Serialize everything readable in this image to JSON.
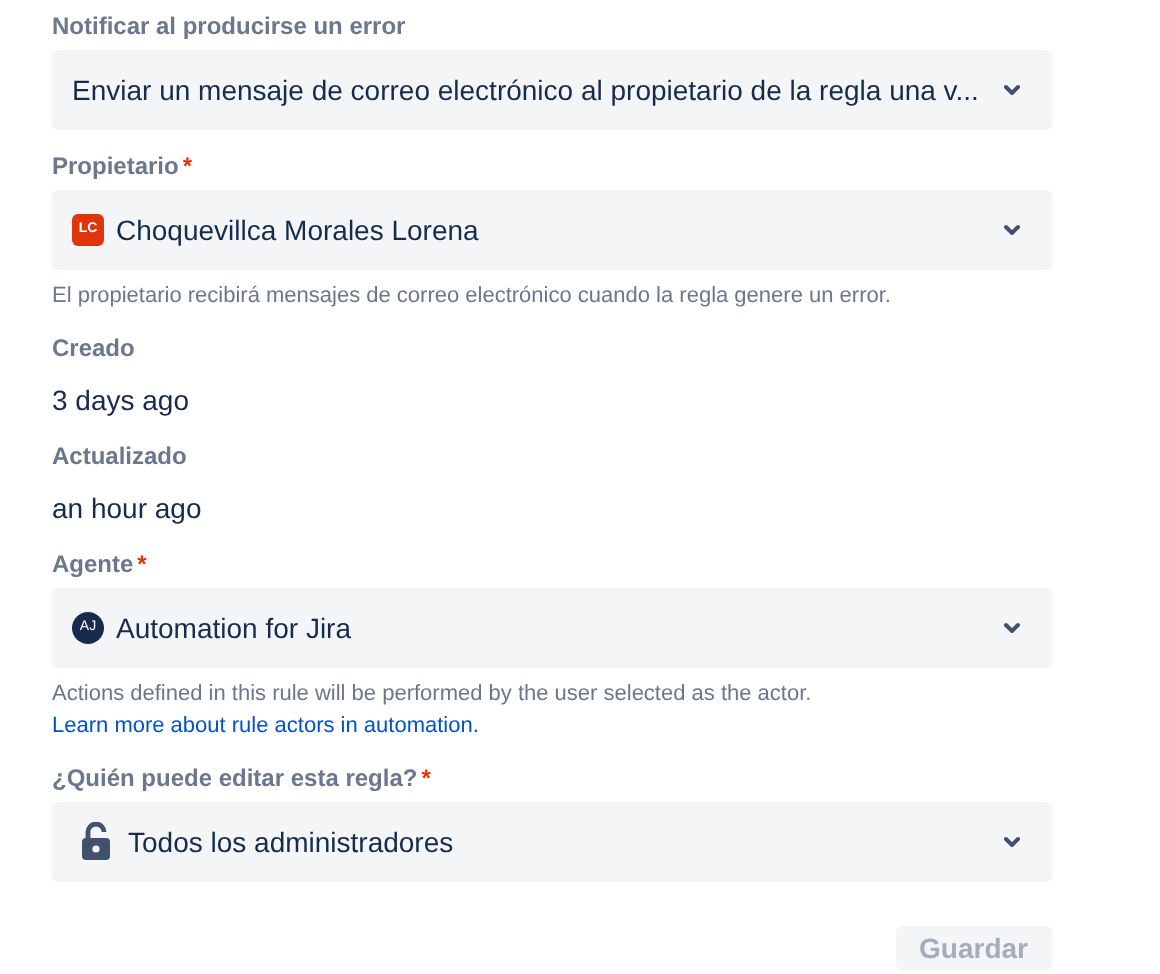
{
  "fields": [
    {
      "kind": "select",
      "label": "Notificar al producirse un error",
      "required": false,
      "value": "Enviar un mensaje de correo electrónico al propietario de la regla una v..."
    },
    {
      "kind": "select",
      "label": "Propietario",
      "required": true,
      "required_mark": "*",
      "value": "Choquevillca Morales Lorena",
      "lead": {
        "kind": "avatar_square",
        "initials": "LC",
        "color": "#de350b"
      },
      "helper": "El propietario recibirá mensajes de correo electrónico cuando la regla genere un error."
    },
    {
      "kind": "text",
      "label": "Creado",
      "value": "3 days ago"
    },
    {
      "kind": "text",
      "label": "Actualizado",
      "value": "an hour ago"
    },
    {
      "kind": "select",
      "label": "Agente",
      "required": true,
      "required_mark": "*",
      "value": "Automation for Jira",
      "lead": {
        "kind": "avatar_round",
        "initials": "AJ",
        "color": "#172b4d"
      },
      "helper": "Actions defined in this rule will be performed by the user selected as the actor.",
      "helper_link": "Learn more about rule actors in automation."
    },
    {
      "kind": "select",
      "label": "¿Quién puede editar esta regla?",
      "required": true,
      "required_mark": "*",
      "value": "Todos los administradores",
      "lead": {
        "kind": "lock"
      }
    }
  ],
  "save_button": {
    "label": "Guardar",
    "disabled": true
  }
}
